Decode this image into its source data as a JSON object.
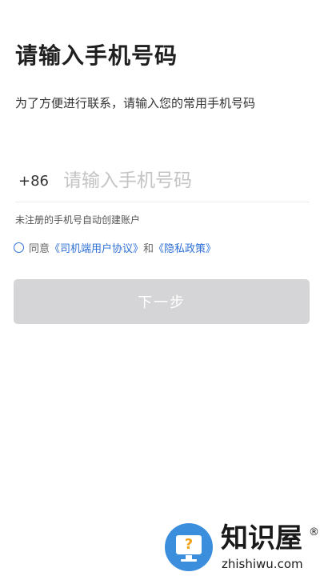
{
  "header": {
    "title": "请输入手机号码",
    "subtitle": "为了方便进行联系，请输入您的常用手机号码"
  },
  "phone": {
    "country_code": "+86",
    "value": "",
    "placeholder": "请输入手机号码"
  },
  "hint": "未注册的手机号自动创建账户",
  "agreement": {
    "checked": false,
    "prefix": "同意",
    "link1": "《司机端用户协议》",
    "conjunction": "和",
    "link2": "《隐私政策》"
  },
  "next_button": {
    "label": "下一步",
    "enabled": false
  },
  "watermark": {
    "brand": "知识屋",
    "registered": "®",
    "domain": "zhishiwu.com",
    "icon_glyph": "?",
    "icon": "monitor-question-icon"
  },
  "colors": {
    "accent": "#2d6fd6",
    "button_disabled": "#d5d5d7",
    "watermark_blue": "#3a8edb"
  }
}
